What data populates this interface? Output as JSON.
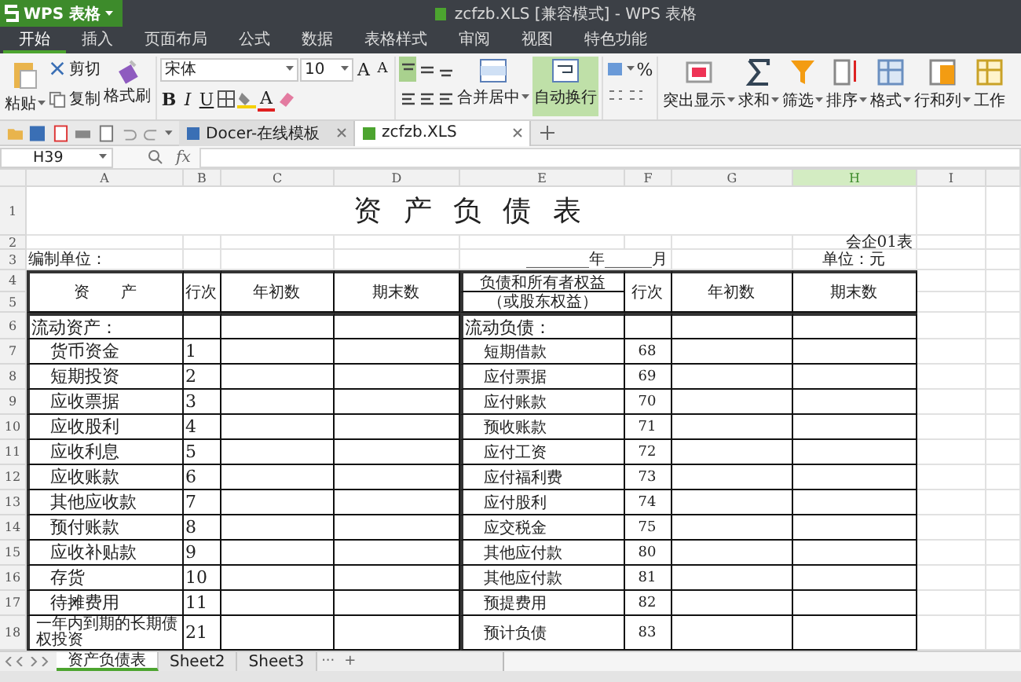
{
  "app": {
    "logo_label": "WPS 表格",
    "title": "zcfzb.XLS [兼容模式] - WPS 表格"
  },
  "menu": [
    {
      "label": "开始",
      "selected": true
    },
    {
      "label": "插入",
      "selected": false
    },
    {
      "label": "页面布局",
      "selected": false
    },
    {
      "label": "公式",
      "selected": false
    },
    {
      "label": "数据",
      "selected": false
    },
    {
      "label": "表格样式",
      "selected": false
    },
    {
      "label": "审阅",
      "selected": false
    },
    {
      "label": "视图",
      "selected": false
    },
    {
      "label": "特色功能",
      "selected": false
    }
  ],
  "ribbon": {
    "paste": "粘贴",
    "cut": "剪切",
    "copy": "复制",
    "format_painter": "格式刷",
    "font_name": "宋体",
    "font_size": "10",
    "grow_font": "A",
    "shrink_font": "A",
    "styles": [
      "B",
      "I",
      "U"
    ],
    "font_color": "A",
    "align_buttons": [
      {
        "selected": true
      },
      {
        "selected": false
      },
      {
        "selected": false
      },
      {
        "selected": false
      },
      {
        "selected": false
      },
      {
        "selected": false
      }
    ],
    "merge": {
      "label": "合并居中",
      "selected": false
    },
    "wrap": {
      "label": "自动换行",
      "selected": true
    },
    "percent": "%",
    "tools": [
      {
        "label": "突出显示"
      },
      {
        "label": "求和"
      },
      {
        "label": "筛选"
      },
      {
        "label": "排序"
      },
      {
        "label": "格式"
      },
      {
        "label": "行和列"
      },
      {
        "label": "工作"
      }
    ]
  },
  "doc_tabs": [
    {
      "label": "Docer-在线模板",
      "selected": false
    },
    {
      "label": "zcfzb.XLS",
      "selected": true
    }
  ],
  "formula_bar": {
    "cell": "H39",
    "fx": "fx"
  },
  "columns": [
    {
      "label": "A",
      "selected": false
    },
    {
      "label": "B",
      "selected": false
    },
    {
      "label": "C",
      "selected": false
    },
    {
      "label": "D",
      "selected": false
    },
    {
      "label": "E",
      "selected": false
    },
    {
      "label": "F",
      "selected": false
    },
    {
      "label": "G",
      "selected": false
    },
    {
      "label": "H",
      "selected": true
    },
    {
      "label": "I",
      "selected": false
    }
  ],
  "row_numbers": [
    "1",
    "2",
    "3",
    "4",
    "5",
    "6",
    "7",
    "8",
    "9",
    "10",
    "11",
    "12",
    "13",
    "14",
    "15",
    "16",
    "17",
    "18"
  ],
  "sheet": {
    "title": "资 产 负 债 表",
    "form_code": "会企01表",
    "company_label": "编制单位：",
    "period": "________年______月",
    "unit": "单位：元",
    "header": {
      "assets": "资　　产",
      "line_no": "行次",
      "begin": "年初数",
      "end": "期末数",
      "liabilities": "负债和所有者权益",
      "liabilities_sub": "（或股东权益）",
      "line_no_2": "行次",
      "begin_2": "年初数",
      "end_2": "期末数"
    },
    "asset_section": "流动资产：",
    "liability_section": "流动负债：",
    "items": [
      {
        "asset": "货币资金",
        "asset_no": "1",
        "liability": "短期借款",
        "liability_no": "68"
      },
      {
        "asset": "短期投资",
        "asset_no": "2",
        "liability": "应付票据",
        "liability_no": "69"
      },
      {
        "asset": "应收票据",
        "asset_no": "3",
        "liability": "应付账款",
        "liability_no": "70"
      },
      {
        "asset": "应收股利",
        "asset_no": "4",
        "liability": "预收账款",
        "liability_no": "71"
      },
      {
        "asset": "应收利息",
        "asset_no": "5",
        "liability": "应付工资",
        "liability_no": "72"
      },
      {
        "asset": "应收账款",
        "asset_no": "6",
        "liability": "应付福利费",
        "liability_no": "73"
      },
      {
        "asset": "其他应收款",
        "asset_no": "7",
        "liability": "应付股利",
        "liability_no": "74"
      },
      {
        "asset": "预付账款",
        "asset_no": "8",
        "liability": "应交税金",
        "liability_no": "75"
      },
      {
        "asset": "应收补贴款",
        "asset_no": "9",
        "liability": "其他应付款",
        "liability_no": "80"
      },
      {
        "asset": "存货",
        "asset_no": "10",
        "liability": "其他应付款",
        "liability_no": "81"
      },
      {
        "asset": "待摊费用",
        "asset_no": "11",
        "liability": "预提费用",
        "liability_no": "82"
      },
      {
        "asset": "一年内到期的长期债权投资",
        "asset_no": "21",
        "liability": "预计负债",
        "liability_no": "83",
        "kind": "small"
      }
    ]
  },
  "sheet_tabs": [
    {
      "label": "资产负债表",
      "selected": true
    },
    {
      "label": "Sheet2",
      "selected": false
    },
    {
      "label": "Sheet3",
      "selected": false
    }
  ],
  "sheet_more": "···",
  "sheet_add": "+"
}
